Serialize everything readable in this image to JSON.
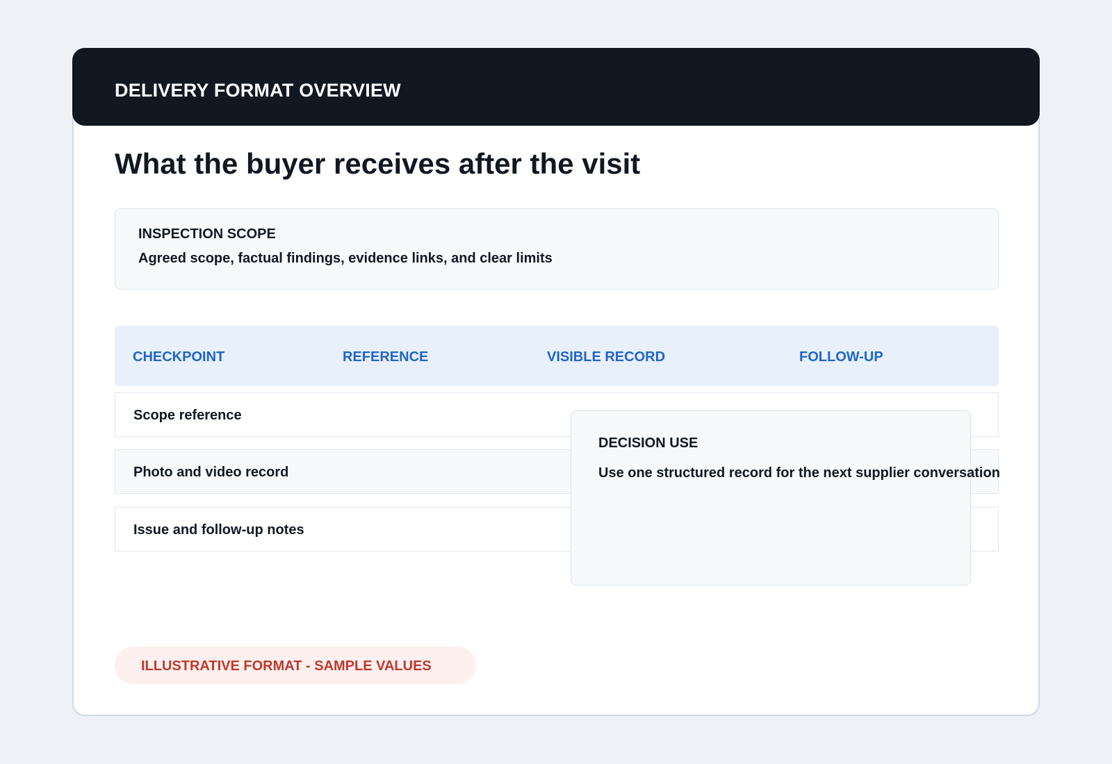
{
  "header": {
    "eyebrow": "DELIVERY FORMAT OVERVIEW",
    "title": "What the buyer receives after the visit"
  },
  "scope": {
    "label": "INSPECTION SCOPE",
    "text": "Agreed scope, factual findings, evidence links, and clear limits"
  },
  "table": {
    "columns": [
      "CHECKPOINT",
      "REFERENCE",
      "VISIBLE RECORD",
      "FOLLOW-UP"
    ],
    "rows": [
      {
        "checkpoint": "Scope reference"
      },
      {
        "checkpoint": "Photo and video record"
      },
      {
        "checkpoint": "Issue and follow-up notes"
      }
    ]
  },
  "decision": {
    "label": "DECISION USE",
    "text": "Use one structured record for the next supplier conversation"
  },
  "badge": {
    "text": "ILLUSTRATIVE FORMAT - SAMPLE VALUES"
  },
  "colors": {
    "header_bg": "#111822",
    "page_bg": "#eef2f6",
    "table_head_bg": "#e8f0fc",
    "column_heading": "#2065c8",
    "badge_bg": "#fdf0ef",
    "badge_text": "#c0392b"
  }
}
